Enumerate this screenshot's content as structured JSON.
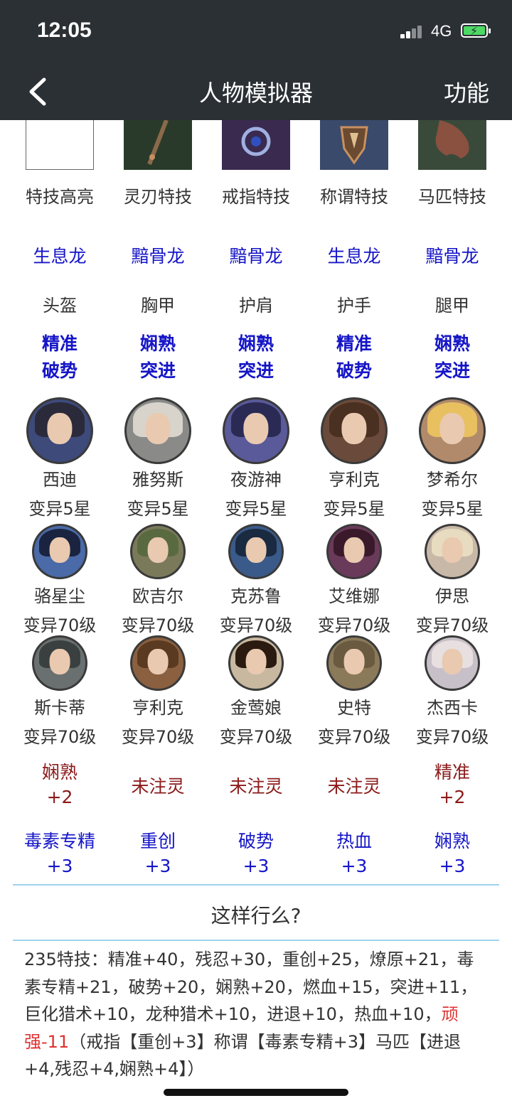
{
  "status": {
    "time": "12:05",
    "network": "4G"
  },
  "nav": {
    "title": "人物模拟器",
    "function": "功能"
  },
  "skill_thumbs": [
    {
      "label": "特技高亮",
      "icon": "empty-box-icon",
      "color": "#ffffff"
    },
    {
      "label": "灵刃特技",
      "icon": "dagger-icon",
      "color": "#2a3a2a"
    },
    {
      "label": "戒指特技",
      "icon": "ring-icon",
      "color": "#3a2a50"
    },
    {
      "label": "称谓特技",
      "icon": "emblem-icon",
      "color": "#3a4a6a"
    },
    {
      "label": "马匹特技",
      "icon": "horse-icon",
      "color": "#3a4a3a"
    }
  ],
  "dragons": [
    "生息龙",
    "黯骨龙",
    "黯骨龙",
    "生息龙",
    "黯骨龙"
  ],
  "armor": [
    {
      "slot": "头盔",
      "line1": "精准",
      "line2": "破势"
    },
    {
      "slot": "胸甲",
      "line1": "娴熟",
      "line2": "突进"
    },
    {
      "slot": "护肩",
      "line1": "娴熟",
      "line2": "突进"
    },
    {
      "slot": "护手",
      "line1": "精准",
      "line2": "破势"
    },
    {
      "slot": "腿甲",
      "line1": "娴熟",
      "line2": "突进"
    }
  ],
  "heroes_main": [
    {
      "name": "西迪",
      "level": "变异5星",
      "hair": "#2a2a3a",
      "bg": "#3d4a7a"
    },
    {
      "name": "雅努斯",
      "level": "变异5星",
      "hair": "#d8d4cc",
      "bg": "#8a8a88"
    },
    {
      "name": "夜游神",
      "level": "变异5星",
      "hair": "#2a2a55",
      "bg": "#5a5a9a"
    },
    {
      "name": "亨利克",
      "level": "变异5星",
      "hair": "#4a3020",
      "bg": "#6a4a3a"
    },
    {
      "name": "梦希尔",
      "level": "变异5星",
      "hair": "#e8c060",
      "bg": "#b08a6a"
    }
  ],
  "heroes_row2": [
    {
      "name": "骆星尘",
      "level": "变异70级",
      "hair": "#1a2440",
      "bg": "#4a6aa8"
    },
    {
      "name": "欧吉尔",
      "level": "变异70级",
      "hair": "#5a6a40",
      "bg": "#7a7a5a"
    },
    {
      "name": "克苏鲁",
      "level": "变异70级",
      "hair": "#1a2a40",
      "bg": "#3a5a8a"
    },
    {
      "name": "艾维娜",
      "level": "变异70级",
      "hair": "#3a1a2a",
      "bg": "#6a3a5a"
    },
    {
      "name": "伊思",
      "level": "变异70级",
      "hair": "#e8dcc0",
      "bg": "#c8b8a8"
    }
  ],
  "heroes_row3": [
    {
      "name": "斯卡蒂",
      "level": "变异70级",
      "hair": "#3a4040",
      "bg": "#6a7070"
    },
    {
      "name": "亨利克",
      "level": "变异70级",
      "hair": "#5a3a20",
      "bg": "#8a6040"
    },
    {
      "name": "金莺娘",
      "level": "变异70级",
      "hair": "#2a1a10",
      "bg": "#c8b8a0"
    },
    {
      "name": "史特",
      "level": "变异70级",
      "hair": "#6a5a40",
      "bg": "#8a7a5a"
    },
    {
      "name": "杰西卡",
      "level": "变异70级",
      "hair": "#e8e0e0",
      "bg": "#c8c0c8"
    }
  ],
  "infusion": [
    {
      "line1": "娴熟",
      "line2": "+2"
    },
    {
      "line1": "未注灵",
      "line2": ""
    },
    {
      "line1": "未注灵",
      "line2": ""
    },
    {
      "line1": "未注灵",
      "line2": ""
    },
    {
      "line1": "精准",
      "line2": "+2"
    }
  ],
  "bonuses": [
    {
      "name": "毒素专精",
      "value": "+3"
    },
    {
      "name": "重创",
      "value": "+3"
    },
    {
      "name": "破势",
      "value": "+3"
    },
    {
      "name": "热血",
      "value": "+3"
    },
    {
      "name": "娴熟",
      "value": "+3"
    }
  ],
  "question": "这样行么?",
  "summary": {
    "part1": "235特技：精准+40，残忍+30，重创+25，燎原+21，毒素专精+21，破势+20，娴熟+20，燃血+15，突进+11，巨化猎术+10，龙种猎术+10，进退+10，热血+10，",
    "highlight": "顽强-11",
    "part2": "（戒指【重创+3】称谓【毒素专精+3】马匹【进退+4,残忍+4,娴熟+4】）"
  },
  "colors": {
    "bar": "#2b3035",
    "blue_text": "#1515c8",
    "dark_red": "#8b1a1a",
    "highlight_red": "#e03030",
    "divider": "#9fd4ee"
  }
}
